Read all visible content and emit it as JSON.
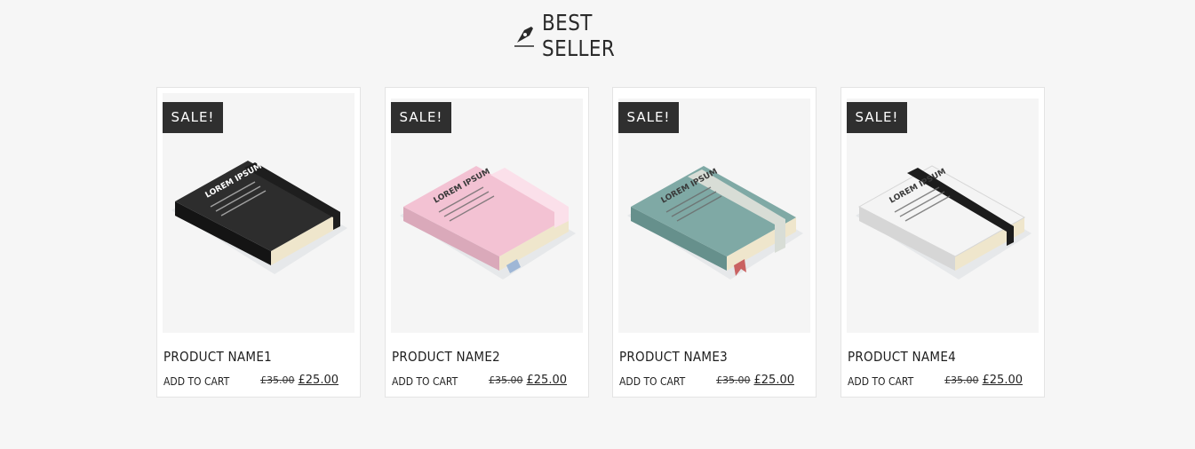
{
  "section": {
    "title": "BEST SELLER",
    "icon": "pen-nib-icon"
  },
  "products": [
    {
      "badge": "SALE!",
      "name": "PRODUCT NAME1",
      "cart_label": "ADD TO CART",
      "old_price": "£35.00",
      "new_price": "£25.00",
      "cover_title": "LOREM IPSUM",
      "cover_color": "#2d2d2d",
      "band_color": "#1e1e1e"
    },
    {
      "badge": "SALE!",
      "name": "PRODUCT NAME2",
      "cart_label": "ADD TO CART",
      "old_price": "£35.00",
      "new_price": "£25.00",
      "cover_title": "LOREM IPSUM",
      "cover_color": "#f3c2d3",
      "band_color": "#fbe0ea"
    },
    {
      "badge": "SALE!",
      "name": "PRODUCT NAME3",
      "cart_label": "ADD TO CART",
      "old_price": "£35.00",
      "new_price": "£25.00",
      "cover_title": "LOREM IPSUM",
      "cover_color": "#7fa9a5",
      "band_color": "#d8ddd6"
    },
    {
      "badge": "SALE!",
      "name": "PRODUCT NAME4",
      "cart_label": "ADD TO CART",
      "old_price": "£35.00",
      "new_price": "£25.00",
      "cover_title": "LOREM IPSUM",
      "cover_color": "#f4f4f4",
      "band_color": "#1c1c1c"
    }
  ]
}
